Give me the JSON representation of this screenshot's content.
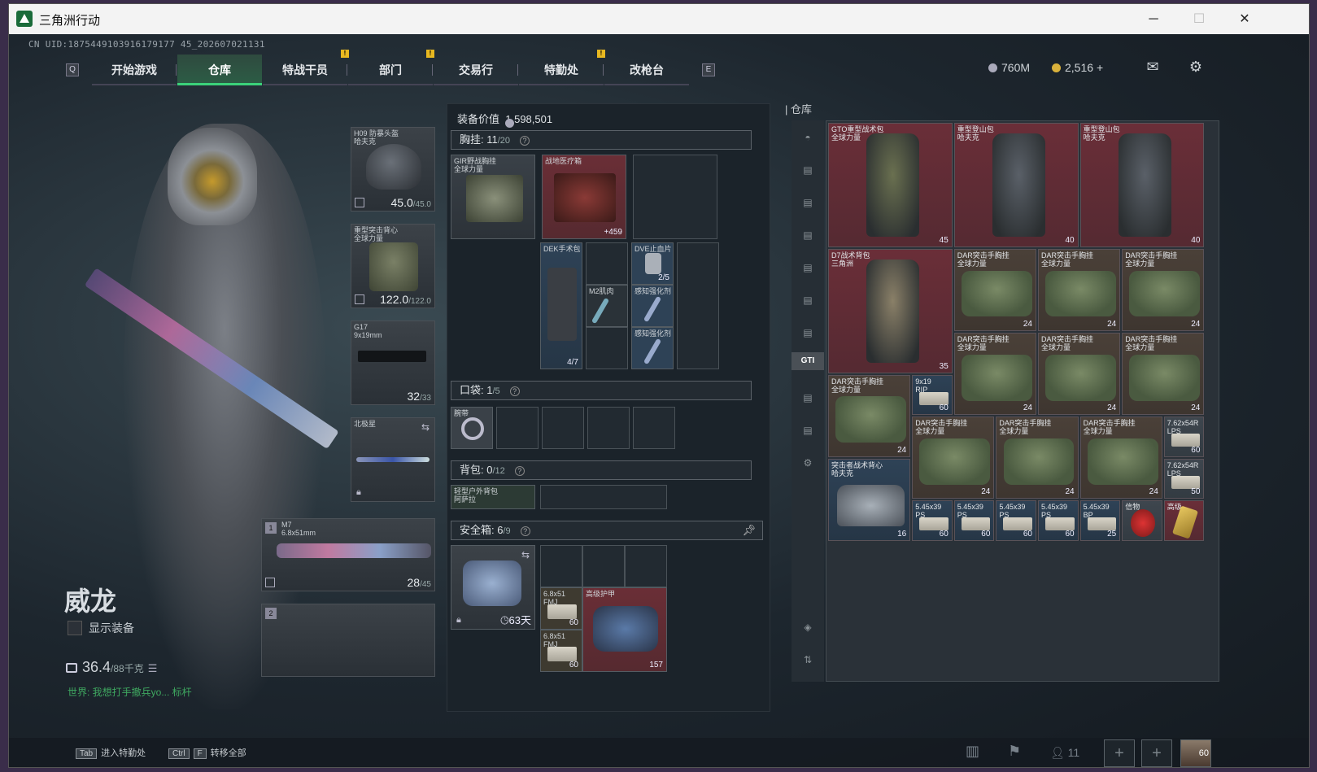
{
  "window": {
    "title": "三角洲行动",
    "minimize": "─",
    "maximize": "☐",
    "close": "✕"
  },
  "uid": "CN UID:1875449103916179177 45_202607021131",
  "nav": {
    "left_key": "Q",
    "right_key": "E",
    "tabs": [
      "开始游戏",
      "仓库",
      "特战干员",
      "部门",
      "交易行",
      "特勤处",
      "改枪台"
    ],
    "active": "仓库",
    "notif": "!"
  },
  "currency": {
    "silver": "760M",
    "gold": "2,516",
    "plus": "+"
  },
  "character": {
    "name": "威龙",
    "show_equipment": "显示装备",
    "weight": "36.4",
    "weight_max": "/88千克",
    "chat": "世界: 我想打手撤兵yo... 标杆"
  },
  "equipment": {
    "helmet": {
      "label": "H09 防暴头盔\n哈夫克",
      "value": "45.0",
      "max": "/45.0"
    },
    "armor": {
      "label": "重型突击背心\n全球力量",
      "value": "122.0",
      "max": "/122.0"
    },
    "pistol": {
      "label": "G17\n9x19mm",
      "value": "32",
      "max": "/33"
    },
    "melee": {
      "label": "北极星"
    },
    "primary": {
      "slot": "1",
      "label": "M7\n6.8x51mm",
      "value": "28",
      "max": "/45"
    },
    "secondary": {
      "slot": "2"
    }
  },
  "middle": {
    "value_label": "装备价值",
    "value": "1,598,501",
    "rig": {
      "label": "胸挂:",
      "count": "11",
      "max": "/20"
    },
    "pocket": {
      "label": "口袋:",
      "count": "1",
      "max": "/5"
    },
    "backpack": {
      "label": "背包:",
      "count": "0",
      "max": "/12"
    },
    "safebox": {
      "label": "安全箱:",
      "count": "6",
      "max": "/9"
    },
    "items": {
      "rig_item": "GIR野战胸挂\n全球力量",
      "medkit": "战地医疗箱",
      "medkit_cnt": "+459",
      "dek": "DEK手术包",
      "dek_cnt": "4/7",
      "dve": "DVE止血片",
      "dve_cnt": "2/5",
      "m2": "M2肌肉",
      "stim1": "感知强化剂",
      "stim2": "感知强化剂",
      "pocket_item": "腕带",
      "backpack_item": "轻型户外背包\n阿萨拉",
      "safebox_days": "63天",
      "ammo1": "6.8x51\nFMJ",
      "ammo1_cnt": "60",
      "ammo2": "6.8x51\nFMJ",
      "ammo2_cnt": "60",
      "armor_bag": "高级护甲",
      "armor_bag_cnt": "157"
    }
  },
  "stash": {
    "title": "仓库",
    "items": [
      {
        "label": "GTO重型战术包\n全球力量",
        "cnt": "45"
      },
      {
        "label": "重型登山包\n哈夫克",
        "cnt": "40"
      },
      {
        "label": "重型登山包\n哈夫克",
        "cnt": "40"
      },
      {
        "label": "D7战术背包\n三角洲",
        "cnt": "35"
      },
      {
        "label": "DAR突击手胸挂\n全球力量",
        "cnt": "24"
      },
      {
        "label": "DAR突击手胸挂\n全球力量",
        "cnt": "24"
      },
      {
        "label": "DAR突击手胸挂\n全球力量",
        "cnt": "24"
      },
      {
        "label": "DAR突击手胸挂\n全球力量",
        "cnt": "24"
      },
      {
        "label": "DAR突击手胸挂\n全球力量",
        "cnt": "24"
      },
      {
        "label": "DAR突击手胸挂\n全球力量",
        "cnt": "24"
      },
      {
        "label": "DAR突击手胸挂\n全球力量",
        "cnt": "24"
      },
      {
        "label": "9x19\nRIP",
        "cnt": "60"
      },
      {
        "label": "DAR突击手胸挂\n全球力量",
        "cnt": "24"
      },
      {
        "label": "DAR突击手胸挂\n全球力量",
        "cnt": "24"
      },
      {
        "label": "DAR突击手胸挂\n全球力量",
        "cnt": "24"
      },
      {
        "label": "7.62x54R\nLPS",
        "cnt": "60"
      },
      {
        "label": "7.62x54R\nLPS",
        "cnt": "50"
      },
      {
        "label": "突击者战术背心\n哈夫克",
        "cnt": "16"
      },
      {
        "label": "5.45x39\nPS",
        "cnt": "60"
      },
      {
        "label": "5.45x39\nPS",
        "cnt": "60"
      },
      {
        "label": "5.45x39\nPS",
        "cnt": "60"
      },
      {
        "label": "5.45x39\nPS",
        "cnt": "60"
      },
      {
        "label": "5.45x39\nBP",
        "cnt": "25"
      },
      {
        "label": "信物",
        "cnt": ""
      },
      {
        "label": "高级",
        "cnt": ""
      }
    ],
    "side_active": "GTI"
  },
  "bottom": {
    "tab_key": "Tab",
    "tab_label": "进入特勤处",
    "ctrl_key": "Ctrl",
    "f_key": "F",
    "ctrl_label": "转移全部",
    "squad": "11",
    "level": "60"
  }
}
